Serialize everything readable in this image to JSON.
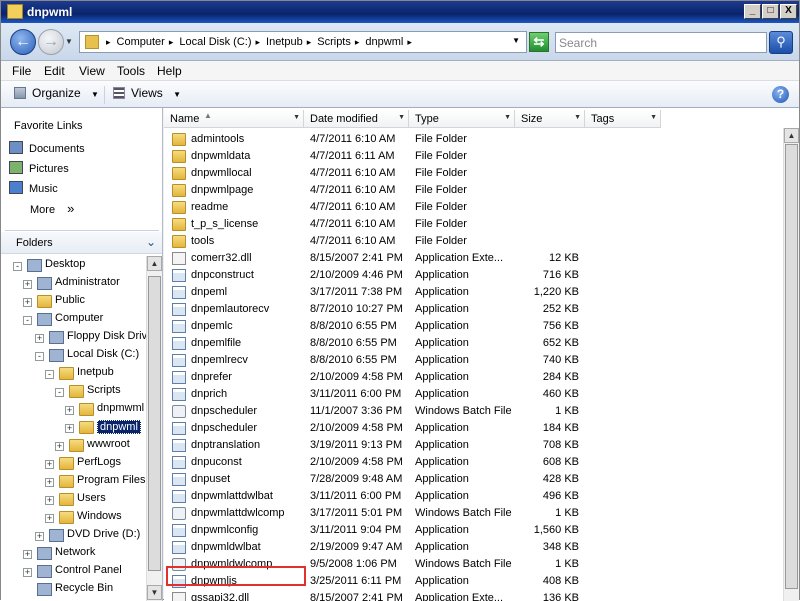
{
  "window": {
    "title": "dnpwml",
    "controls": {
      "minimize": "_",
      "maximize": "□",
      "close": "X"
    }
  },
  "address": {
    "crumbs": [
      "Computer",
      "Local Disk (C:)",
      "Inetpub",
      "Scripts",
      "dnpwml"
    ],
    "search_placeholder": "Search"
  },
  "menu": [
    "File",
    "Edit",
    "View",
    "Tools",
    "Help"
  ],
  "toolbar": {
    "organize": "Organize",
    "views": "Views"
  },
  "favorites": {
    "header": "Favorite Links",
    "items": [
      {
        "label": "Documents",
        "icon": "documents-icon"
      },
      {
        "label": "Pictures",
        "icon": "pictures-icon"
      },
      {
        "label": "Music",
        "icon": "music-icon"
      },
      {
        "label": "More",
        "icon": "chevron-right-icon"
      }
    ],
    "more_glyph": "»"
  },
  "folders_header": "Folders",
  "tree": [
    {
      "label": "Desktop",
      "level": 0,
      "expander": "-"
    },
    {
      "label": "Administrator",
      "level": 1,
      "expander": "+"
    },
    {
      "label": "Public",
      "level": 1,
      "expander": "+"
    },
    {
      "label": "Computer",
      "level": 1,
      "expander": "-"
    },
    {
      "label": "Floppy Disk Drive",
      "level": 2,
      "expander": "+"
    },
    {
      "label": "Local Disk (C:)",
      "level": 2,
      "expander": "-"
    },
    {
      "label": "Inetpub",
      "level": 3,
      "expander": "-"
    },
    {
      "label": "Scripts",
      "level": 4,
      "expander": "-"
    },
    {
      "label": "dnpmwml",
      "level": 5,
      "expander": "+"
    },
    {
      "label": "dnpwml",
      "level": 5,
      "expander": "+",
      "selected": true
    },
    {
      "label": "wwwroot",
      "level": 4,
      "expander": "+"
    },
    {
      "label": "PerfLogs",
      "level": 3,
      "expander": "+"
    },
    {
      "label": "Program Files",
      "level": 3,
      "expander": "+"
    },
    {
      "label": "Users",
      "level": 3,
      "expander": "+"
    },
    {
      "label": "Windows",
      "level": 3,
      "expander": "+"
    },
    {
      "label": "DVD Drive (D:)",
      "level": 2,
      "expander": "+"
    },
    {
      "label": "Network",
      "level": 1,
      "expander": "+"
    },
    {
      "label": "Control Panel",
      "level": 1,
      "expander": "+"
    },
    {
      "label": "Recycle Bin",
      "level": 1,
      "expander": ""
    }
  ],
  "columns": [
    "Name",
    "Date modified",
    "Type",
    "Size",
    "Tags"
  ],
  "files": [
    {
      "name": "admintools",
      "date": "4/7/2011 6:10 AM",
      "type": "File Folder",
      "size": "",
      "icon": "folder-icon"
    },
    {
      "name": "dnpwmldata",
      "date": "4/7/2011 6:11 AM",
      "type": "File Folder",
      "size": "",
      "icon": "folder-icon"
    },
    {
      "name": "dnpwmllocal",
      "date": "4/7/2011 6:10 AM",
      "type": "File Folder",
      "size": "",
      "icon": "folder-icon"
    },
    {
      "name": "dnpwmlpage",
      "date": "4/7/2011 6:10 AM",
      "type": "File Folder",
      "size": "",
      "icon": "folder-icon"
    },
    {
      "name": "readme",
      "date": "4/7/2011 6:10 AM",
      "type": "File Folder",
      "size": "",
      "icon": "folder-icon"
    },
    {
      "name": "t_p_s_license",
      "date": "4/7/2011 6:10 AM",
      "type": "File Folder",
      "size": "",
      "icon": "folder-icon"
    },
    {
      "name": "tools",
      "date": "4/7/2011 6:10 AM",
      "type": "File Folder",
      "size": "",
      "icon": "folder-icon"
    },
    {
      "name": "comerr32.dll",
      "date": "8/15/2007 2:41 PM",
      "type": "Application Exte...",
      "size": "12 KB",
      "icon": "extension-icon"
    },
    {
      "name": "dnpconstruct",
      "date": "2/10/2009 4:46 PM",
      "type": "Application",
      "size": "716 KB",
      "icon": "application-icon"
    },
    {
      "name": "dnpeml",
      "date": "3/17/2011 7:38 PM",
      "type": "Application",
      "size": "1,220 KB",
      "icon": "application-icon"
    },
    {
      "name": "dnpemlautorecv",
      "date": "8/7/2010 10:27 PM",
      "type": "Application",
      "size": "252 KB",
      "icon": "application-icon"
    },
    {
      "name": "dnpemlc",
      "date": "8/8/2010 6:55 PM",
      "type": "Application",
      "size": "756 KB",
      "icon": "application-icon"
    },
    {
      "name": "dnpemlfile",
      "date": "8/8/2010 6:55 PM",
      "type": "Application",
      "size": "652 KB",
      "icon": "application-icon"
    },
    {
      "name": "dnpemlrecv",
      "date": "8/8/2010 6:55 PM",
      "type": "Application",
      "size": "740 KB",
      "icon": "application-icon"
    },
    {
      "name": "dnprefer",
      "date": "2/10/2009 4:58 PM",
      "type": "Application",
      "size": "284 KB",
      "icon": "application-icon"
    },
    {
      "name": "dnprich",
      "date": "3/11/2011 6:00 PM",
      "type": "Application",
      "size": "460 KB",
      "icon": "application-icon"
    },
    {
      "name": "dnpscheduler",
      "date": "11/1/2007 3:36 PM",
      "type": "Windows Batch File",
      "size": "1 KB",
      "icon": "batch-file-icon"
    },
    {
      "name": "dnpscheduler",
      "date": "2/10/2009 4:58 PM",
      "type": "Application",
      "size": "184 KB",
      "icon": "application-icon"
    },
    {
      "name": "dnptranslation",
      "date": "3/19/2011 9:13 PM",
      "type": "Application",
      "size": "708 KB",
      "icon": "application-icon"
    },
    {
      "name": "dnpuconst",
      "date": "2/10/2009 4:58 PM",
      "type": "Application",
      "size": "608 KB",
      "icon": "application-icon"
    },
    {
      "name": "dnpuset",
      "date": "7/28/2009 9:48 AM",
      "type": "Application",
      "size": "428 KB",
      "icon": "application-icon"
    },
    {
      "name": "dnpwmlattdwlbat",
      "date": "3/11/2011 6:00 PM",
      "type": "Application",
      "size": "496 KB",
      "icon": "application-icon"
    },
    {
      "name": "dnpwmlattdwlcomp",
      "date": "3/17/2011 5:01 PM",
      "type": "Windows Batch File",
      "size": "1 KB",
      "icon": "batch-file-icon"
    },
    {
      "name": "dnpwmlconfig",
      "date": "3/11/2011 9:04 PM",
      "type": "Application",
      "size": "1,560 KB",
      "icon": "application-icon"
    },
    {
      "name": "dnpwmldwlbat",
      "date": "2/19/2009 9:47 AM",
      "type": "Application",
      "size": "348 KB",
      "icon": "application-icon"
    },
    {
      "name": "dnpwmldwlcomp",
      "date": "9/5/2008 1:06 PM",
      "type": "Windows Batch File",
      "size": "1 KB",
      "icon": "batch-file-icon"
    },
    {
      "name": "dnpwmljs",
      "date": "3/25/2011 6:11 PM",
      "type": "Application",
      "size": "408 KB",
      "icon": "application-icon",
      "highlighted": true
    },
    {
      "name": "gssapi32.dll",
      "date": "8/15/2007 2:41 PM",
      "type": "Application Exte...",
      "size": "136 KB",
      "icon": "extension-icon"
    }
  ],
  "colors": {
    "highlight_border": "#e03030",
    "selection": "#0a246a",
    "folder": "#e8c04e"
  }
}
